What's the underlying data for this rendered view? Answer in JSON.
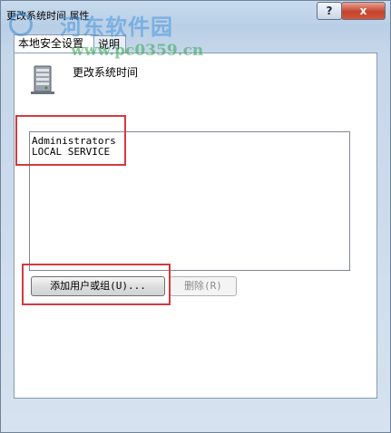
{
  "window": {
    "title": "更改系统时间 属性",
    "help_label": "?",
    "close_label": "x"
  },
  "watermark": {
    "title": "河东软件园",
    "url": "www.pc0359.cn"
  },
  "tabs": [
    {
      "label": "本地安全设置"
    },
    {
      "label": "说明"
    }
  ],
  "policy": {
    "name": "更改系统时间",
    "icon": "server-policy-icon"
  },
  "members": [
    {
      "name": "Administrators"
    },
    {
      "name": "LOCAL SERVICE"
    }
  ],
  "buttons": {
    "add_label": "添加用户或组(U)...",
    "remove_label": "删除(R)"
  },
  "colors": {
    "highlight": "#d23a3f",
    "close_button": "#c4432c"
  }
}
